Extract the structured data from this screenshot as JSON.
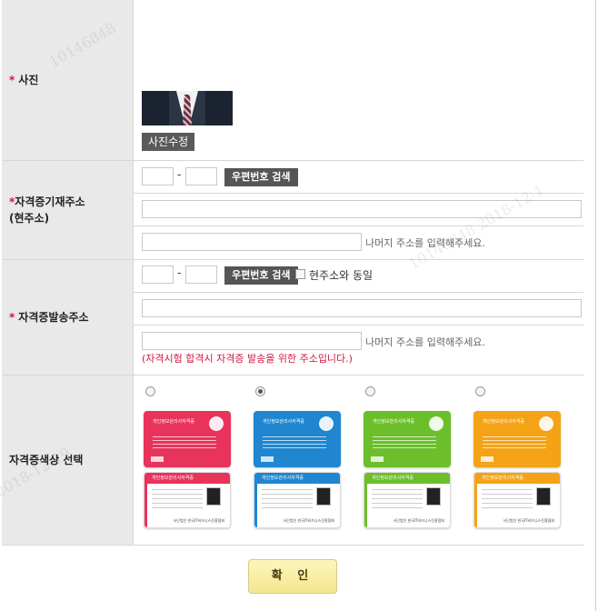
{
  "photo": {
    "label": "사진",
    "edit_button": "사진수정"
  },
  "license_address": {
    "label_line1": "자격증기재주소",
    "label_line2": "(현주소)",
    "zip_search": "우편번호 검색",
    "dash": "-",
    "zip1": "",
    "zip2": "",
    "address1": "",
    "address2": "",
    "detail_hint": "나머지 주소를 입력해주세요."
  },
  "delivery_address": {
    "label": "자격증발송주소",
    "zip_search": "우편번호 검색",
    "dash": "-",
    "same_as_current": "현주소와 동일",
    "zip1": "",
    "zip2": "",
    "address1": "",
    "address2": "",
    "detail_hint": "나머지 주소를 입력해주세요.",
    "note": "(자격시험 합격시 자격증 발송을 위한 주소입니다.)"
  },
  "card_color": {
    "label": "자격증색상 선택",
    "selected_index": 1,
    "card_title": "개인정보관리사자격증",
    "issuer": "사단법인 한국IT비즈니스진흥협회",
    "options": [
      {
        "name": "red",
        "color": "#e8335b"
      },
      {
        "name": "blue",
        "color": "#1f86cf"
      },
      {
        "name": "green",
        "color": "#6cbf2a"
      },
      {
        "name": "orange",
        "color": "#f4a316"
      }
    ]
  },
  "submit_label": "확 인",
  "required_mark": "*",
  "watermarks": [
    "10146848",
    "10146848  2018-12-1",
    "2018-12-19"
  ]
}
